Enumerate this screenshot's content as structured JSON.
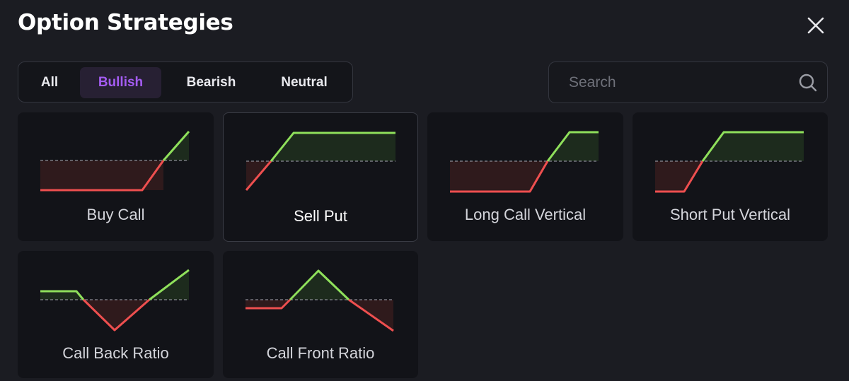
{
  "dialog": {
    "title": "Option Strategies"
  },
  "filters": {
    "tabs": [
      {
        "label": "All",
        "active": false
      },
      {
        "label": "Bullish",
        "active": true
      },
      {
        "label": "Bearish",
        "active": false
      },
      {
        "label": "Neutral",
        "active": false
      }
    ]
  },
  "search": {
    "placeholder": "Search",
    "value": ""
  },
  "colors": {
    "accent": "#a45cf2",
    "profit_line": "#8fe05b",
    "loss_line": "#ee4f4f",
    "profit_fill": "#1d2b1d",
    "loss_fill": "#2f1a1c",
    "breakeven_line": "#8a8c94"
  },
  "strategies": [
    {
      "name": "Buy Call",
      "highlighted": false
    },
    {
      "name": "Sell Put",
      "highlighted": true
    },
    {
      "name": "Long Call Vertical",
      "highlighted": false
    },
    {
      "name": "Short Put Vertical",
      "highlighted": false
    },
    {
      "name": "Call Back Ratio",
      "highlighted": false
    },
    {
      "name": "Call Front Ratio",
      "highlighted": false
    }
  ]
}
